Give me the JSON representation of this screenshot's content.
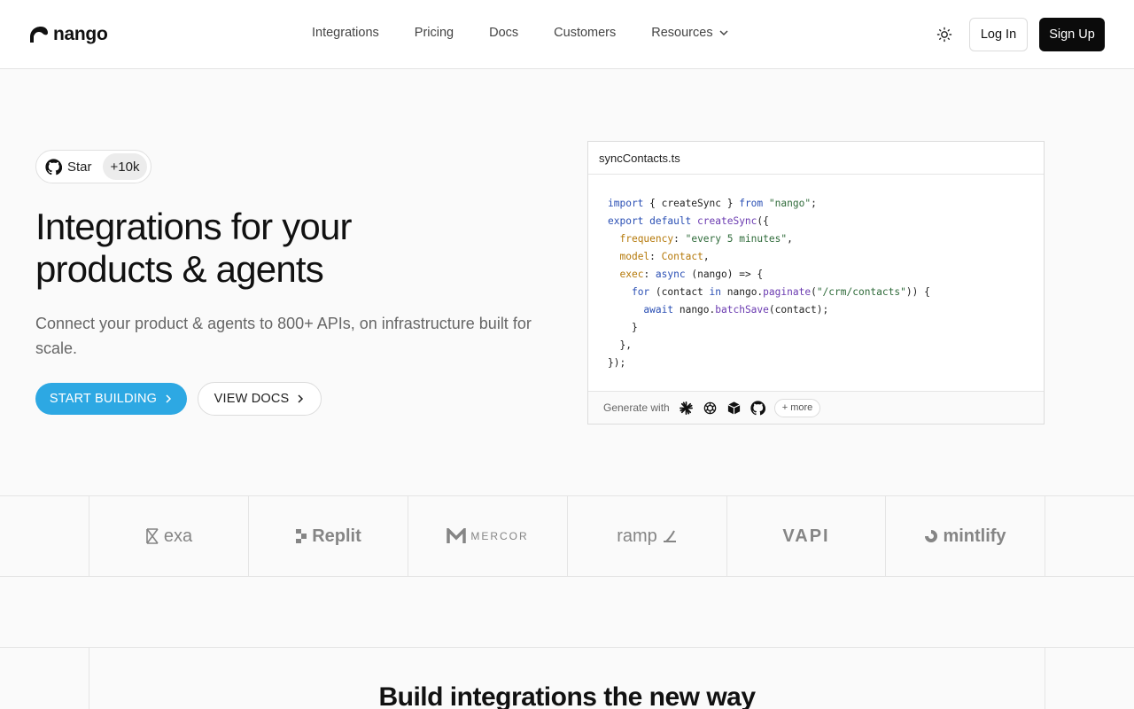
{
  "header": {
    "brand": "nango",
    "nav": [
      {
        "label": "Integrations"
      },
      {
        "label": "Pricing"
      },
      {
        "label": "Docs"
      },
      {
        "label": "Customers"
      },
      {
        "label": "Resources"
      }
    ],
    "login_label": "Log In",
    "signup_label": "Sign Up"
  },
  "hero": {
    "star_label": "Star",
    "star_count": "+10k",
    "title_line1": "Integrations for your",
    "title_line2": "products & agents",
    "subtitle": "Connect your product & agents to 800+ APIs, on infrastructure built for scale.",
    "start_label": "START BUILDING",
    "docs_label": "VIEW DOCS"
  },
  "code": {
    "filename": "syncContacts.ts",
    "generate_label": "Generate with",
    "more_label": "+ more",
    "generators": [
      "claude-icon",
      "openai-icon",
      "cube-icon",
      "github-icon"
    ]
  },
  "customers": [
    {
      "name": "exa"
    },
    {
      "name": "Replit"
    },
    {
      "name": "MERCOR"
    },
    {
      "name": "ramp"
    },
    {
      "name": "VAPI"
    },
    {
      "name": "mintlify"
    }
  ],
  "section": {
    "title": "Build integrations the new way"
  },
  "colors": {
    "accent": "#2da8e3",
    "dark": "#0b0b0b",
    "border": "#e5e5e5"
  }
}
